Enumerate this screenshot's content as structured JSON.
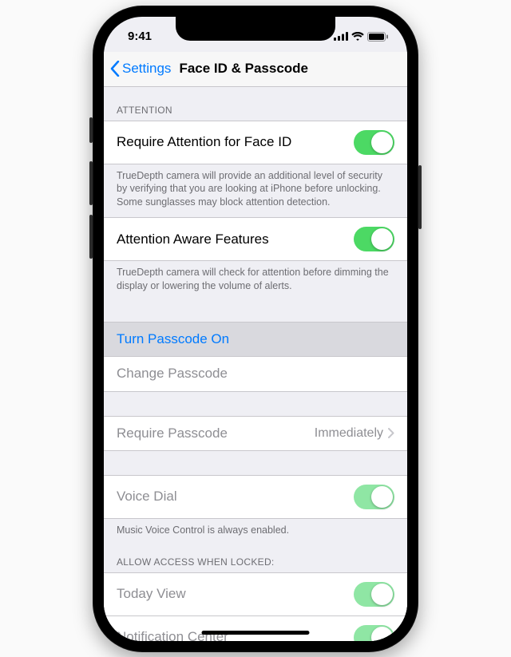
{
  "statusbar": {
    "time": "9:41"
  },
  "nav": {
    "back": "Settings",
    "title": "Face ID & Passcode"
  },
  "sections": {
    "attention": {
      "header": "ATTENTION",
      "requireAttention": {
        "label": "Require Attention for Face ID",
        "on": true
      },
      "requireAttentionFooter": "TrueDepth camera will provide an additional level of security by verifying that you are looking at iPhone before unlocking. Some sunglasses may block attention detection.",
      "awareFeatures": {
        "label": "Attention Aware Features",
        "on": true
      },
      "awareFeaturesFooter": "TrueDepth camera will check for attention before dimming the display or lowering the volume of alerts."
    },
    "passcode": {
      "turnOn": "Turn Passcode On",
      "change": "Change Passcode",
      "require": {
        "label": "Require Passcode",
        "value": "Immediately"
      }
    },
    "voice": {
      "label": "Voice Dial",
      "on": true,
      "footer": "Music Voice Control is always enabled."
    },
    "locked": {
      "header": "ALLOW ACCESS WHEN LOCKED:",
      "today": {
        "label": "Today View",
        "on": true
      },
      "notif": {
        "label": "Notification Center",
        "on": true
      }
    }
  }
}
